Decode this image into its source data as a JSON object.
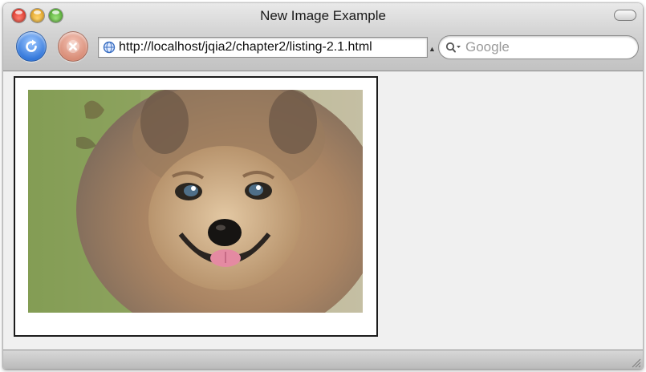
{
  "window": {
    "title": "New Image Example"
  },
  "toolbar": {
    "reload_icon": "reload-icon",
    "stop_icon": "stop-icon",
    "url": "http://localhost/jqia2/chapter2/listing-2.1.html",
    "search_placeholder": "Google"
  },
  "content": {
    "image_subject": "pomeranian-dog-photo"
  },
  "colors": {
    "reload_blue": "#2f74d8",
    "stop_salmon": "#d78a74",
    "close_red": "#d0241a",
    "minimize_yellow": "#d89313",
    "zoom_green": "#3e9a1f"
  }
}
